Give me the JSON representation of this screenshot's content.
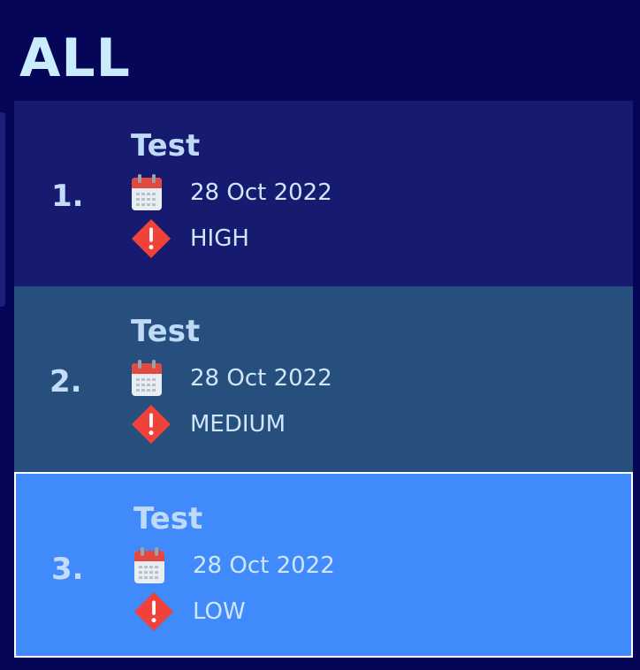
{
  "header": {
    "title": "ALL"
  },
  "tasks": [
    {
      "index": "1.",
      "title": "Test",
      "date": "28 Oct 2022",
      "priority": "HIGH",
      "state": "normal",
      "color": "#161b70"
    },
    {
      "index": "2.",
      "title": "Test",
      "date": "28 Oct 2022",
      "priority": "MEDIUM",
      "state": "hovered",
      "color": "#274f7d"
    },
    {
      "index": "3.",
      "title": "Test",
      "date": "28 Oct 2022",
      "priority": "LOW",
      "state": "selected",
      "color": "#418afc"
    }
  ],
  "icons": {
    "date": "calendar-icon",
    "priority": "priority-warning-icon"
  },
  "colors": {
    "background": "#050657",
    "header_text": "#c9ecff",
    "priority_icon": "#f0413b"
  }
}
